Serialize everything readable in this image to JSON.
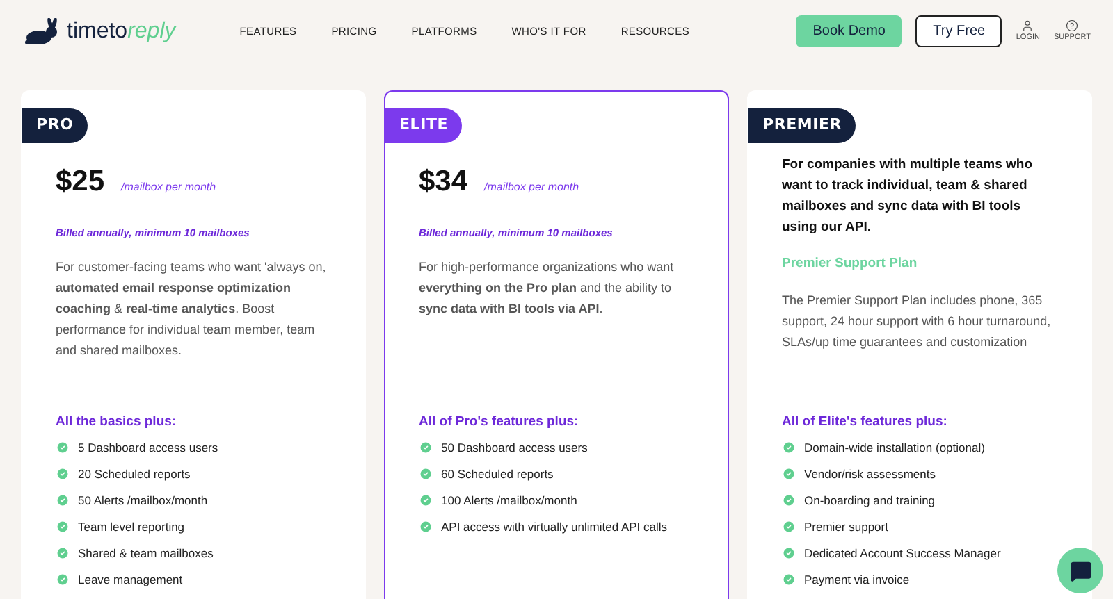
{
  "logo": {
    "part_1": "timeto",
    "part_2": "reply"
  },
  "nav": [
    "FEATURES",
    "PRICING",
    "PLATFORMS",
    "WHO'S IT FOR",
    "RESOURCES"
  ],
  "buttons": {
    "book_demo": "Book Demo",
    "try_free": "Try Free"
  },
  "header_links": [
    {
      "kind": "user",
      "label": "LOGIN"
    },
    {
      "kind": "help",
      "label": "SUPPORT"
    }
  ],
  "plans": [
    {
      "badge": "PRO",
      "selected": false,
      "price": "$25",
      "per": "/mailbox per month",
      "billing": "Billed annually, minimum 10 mailboxes",
      "description": "For customer-facing teams who want 'always on, **automated email response optimization coaching** & **real-time analytics**. Boost performance for individual team member, team and shared mailboxes.",
      "features_title": "All the basics plus:",
      "features": [
        "5 Dashboard access users",
        "20 Scheduled reports",
        "50 Alerts /mailbox/month",
        "Team level reporting",
        "Shared & team mailboxes",
        "Leave management"
      ]
    },
    {
      "badge": "ELITE",
      "selected": true,
      "price": "$34",
      "per": "/mailbox per month",
      "billing": "Billed annually, minimum 10 mailboxes",
      "description": "For high-performance organizations who want **everything on the Pro plan** and the ability to **sync data with BI tools via API**.",
      "features_title": "All of Pro's features plus:",
      "features": [
        "50 Dashboard access users",
        "60 Scheduled reports",
        "100 Alerts /mailbox/month",
        "API access with virtually unlimited API calls"
      ]
    },
    {
      "badge": "PREMIER",
      "selected": false,
      "intro": "For companies with multiple teams who want to track individual, team & shared mailboxes and sync data with BI tools using our API.",
      "support_title": "Premier Support Plan",
      "description": "The Premier Support Plan includes phone, 365 support, 24 hour support with 6 hour turnaround, SLAs/up time guarantees and customization",
      "features_title": "All of Elite's features plus:",
      "features": [
        "Domain-wide installation (optional)",
        "Vendor/risk assessments",
        "On-boarding and training",
        "Premier support",
        "Dedicated Account Success Manager",
        "Payment via invoice"
      ]
    }
  ]
}
